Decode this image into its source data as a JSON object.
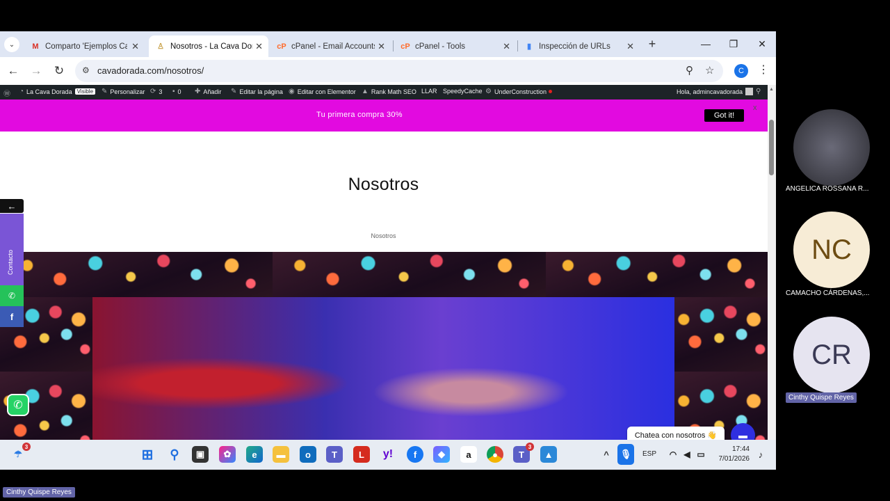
{
  "browser": {
    "tabs": [
      {
        "label": "Comparto 'Ejemplos Cate",
        "icon": "gmail-icon",
        "active": false
      },
      {
        "label": "Nosotros - La Cava Dorad",
        "icon": "site-icon",
        "active": true
      },
      {
        "label": "cPanel - Email Accounts",
        "icon": "cpanel-icon",
        "active": false
      },
      {
        "label": "cPanel - Tools",
        "icon": "cpanel-icon",
        "active": false
      },
      {
        "label": "Inspección de URLs",
        "icon": "search-console-icon",
        "active": false
      }
    ],
    "url": "cavadorada.com/nosotros/",
    "profile_initial": "C"
  },
  "admin_bar": {
    "site": "La Cava Dorada",
    "visible_badge": "Visible",
    "customize": "Personalizar",
    "updates": "3",
    "comments": "0",
    "add_new": "Añadir",
    "edit_page": "Editar la página",
    "edit_elementor": "Editar con Elementor",
    "rank_math": "Rank Math SEO",
    "llar": "LLAR",
    "speedy": "SpeedyCache",
    "under_construction": "UnderConstruction",
    "greeting": "Hola, admincavadorada"
  },
  "promo": {
    "text": "Tu primera  compra 30%",
    "button": "Got it!",
    "close": "x"
  },
  "page": {
    "title": "Nosotros",
    "breadcrumb": "Nosotros"
  },
  "widgets": {
    "contact_label": "Contacto",
    "chat_prompt": "Chatea con nosotros 👋"
  },
  "taskbar": {
    "weather_badge": "3",
    "teams_badge": "3",
    "lang": "ESP",
    "time": "17:44",
    "date": "7/01/2026"
  },
  "meeting": {
    "participants": [
      {
        "name": "ANGELICA ROSSANA R...",
        "initials": ""
      },
      {
        "name": "CAMACHO CÁRDENAS,...",
        "initials": "NC"
      },
      {
        "name": "Cinthy Quispe Reyes",
        "initials": "CR"
      }
    ],
    "self_name": "Cinthy Quispe Reyes"
  },
  "colors": {
    "promo": "#e20ae0",
    "admin_bar": "#1d2327",
    "contact_tab": "#7a55d6",
    "chat_button": "#2f2fe0",
    "nc_avatar": "#f7ecd6",
    "cr_avatar": "#e6e4f0"
  }
}
